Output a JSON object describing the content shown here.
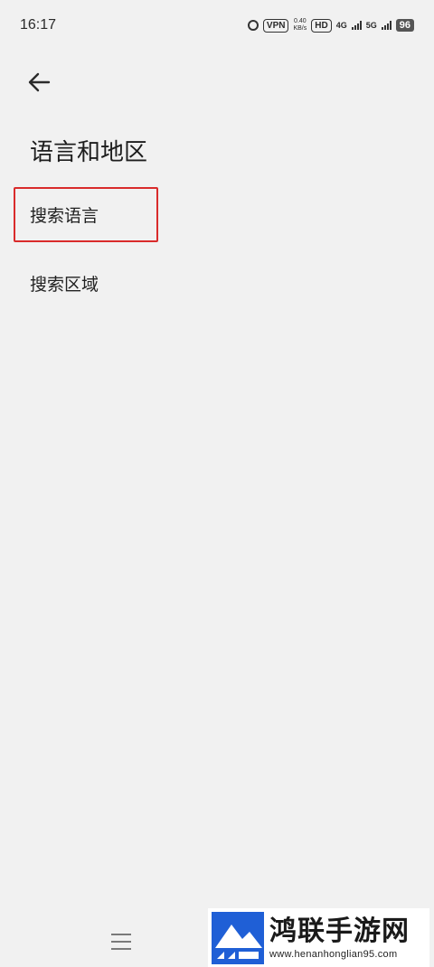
{
  "status_bar": {
    "time": "16:17",
    "vpn": "VPN",
    "net_speed_value": "0.40",
    "net_speed_unit": "KB/s",
    "hd_label": "HD",
    "sim1_network": "4G",
    "sim2_network": "5G",
    "battery": "96"
  },
  "page": {
    "title": "语言和地区"
  },
  "menu": {
    "items": [
      {
        "label": "搜索语言",
        "highlighted": true
      },
      {
        "label": "搜索区域",
        "highlighted": false
      }
    ]
  },
  "highlight_color": "#d92b2b",
  "watermark": {
    "title": "鸿联手游网",
    "url": "www.henanhonglian95.com"
  }
}
